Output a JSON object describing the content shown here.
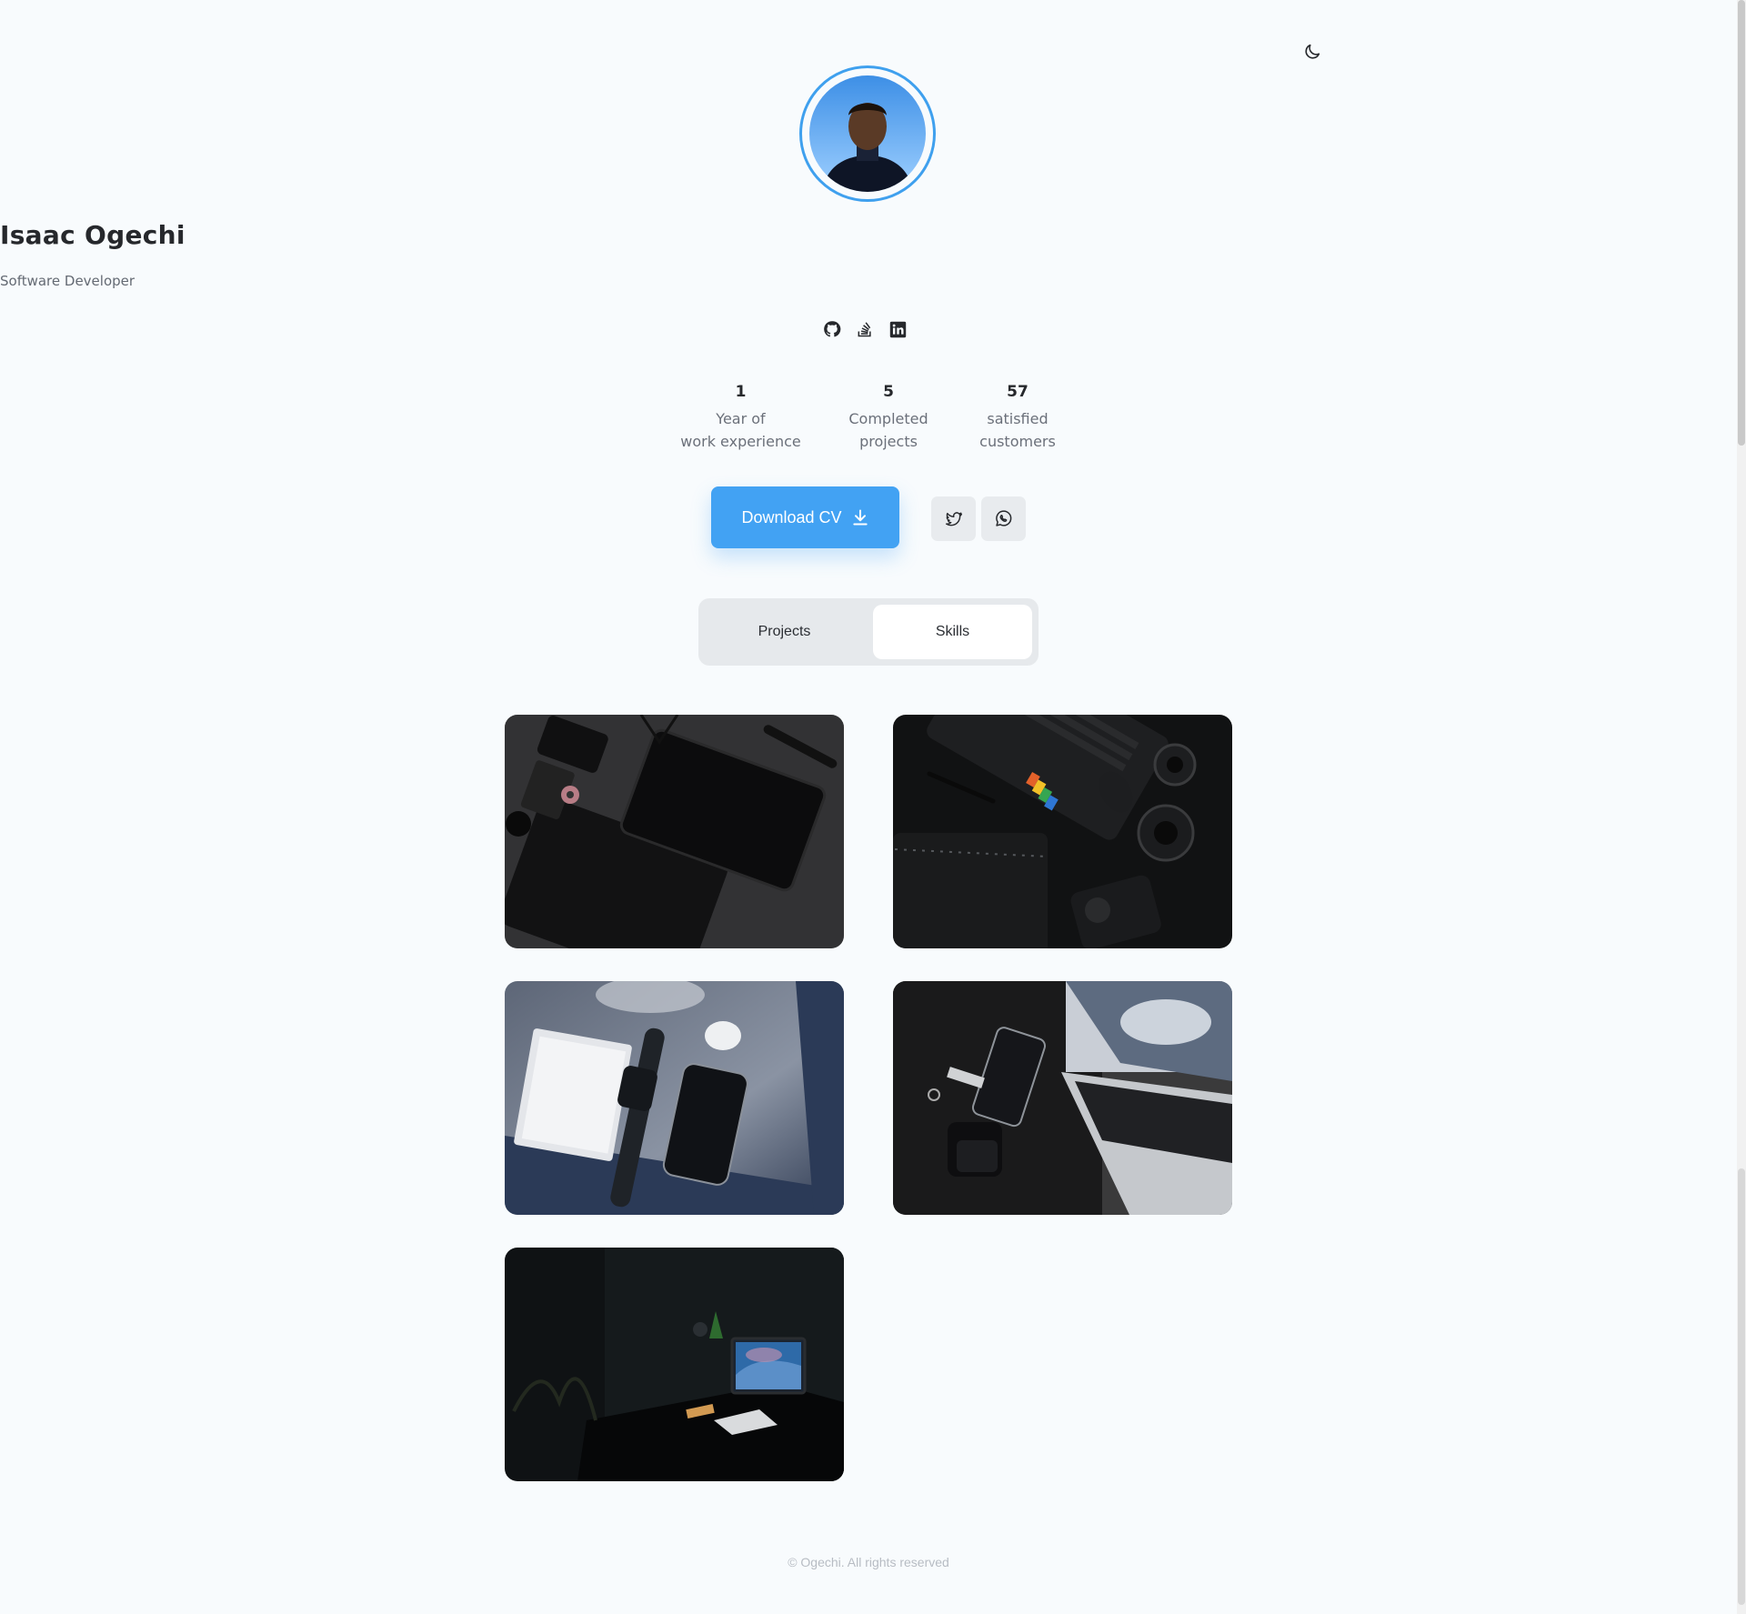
{
  "profile": {
    "name": "Isaac Ogechi",
    "role": "Software Developer"
  },
  "social_icons": [
    "github-icon",
    "stack-overflow-icon",
    "linkedin-icon"
  ],
  "stats": [
    {
      "value": "1",
      "label_line1": "Year of",
      "label_line2": "work experience"
    },
    {
      "value": "5",
      "label_line1": "Completed",
      "label_line2": "projects"
    },
    {
      "value": "57",
      "label_line1": "satisfied",
      "label_line2": "customers"
    }
  ],
  "actions": {
    "download_label": "Download CV",
    "twitter_icon": "twitter-icon",
    "whatsapp_icon": "whatsapp-icon"
  },
  "tabs": [
    {
      "label": "Projects",
      "active": false
    },
    {
      "label": "Skills",
      "active": true
    }
  ],
  "projects": [
    {
      "theme": "dark desk with tablets"
    },
    {
      "theme": "laptop, camera and lenses"
    },
    {
      "theme": "notepad, watch and phone"
    },
    {
      "theme": "laptop with phone and accessories"
    },
    {
      "theme": "dark room workstation"
    }
  ],
  "footer": {
    "text": "© Ogechi. All rights reserved"
  },
  "colors": {
    "accent": "#42a2f3",
    "background": "#f8fbfd",
    "text": "#26282c",
    "muted": "#6b707a"
  }
}
